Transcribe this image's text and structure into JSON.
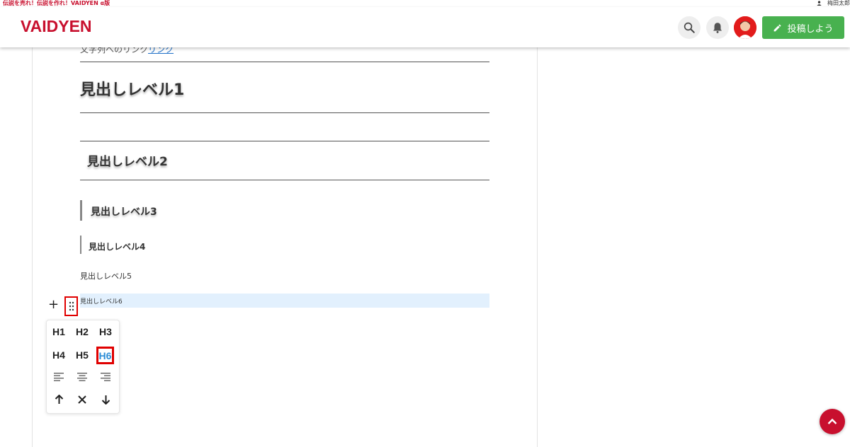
{
  "topbar": {
    "tagline": "伝説を売れ！伝説を作れ！VAIDYEN α版",
    "username": "梅田太郎"
  },
  "header": {
    "logo": "VAIDYEN",
    "post_button_label": "投稿しよう",
    "icons": [
      "search-icon",
      "bell-icon",
      "avatar",
      "pencil-icon"
    ]
  },
  "content": {
    "link_prefix": "文字列へのリンク",
    "link_text": "リンク",
    "heading1": "見出しレベル1",
    "heading2": "見出しレベル2",
    "heading3": "見出しレベル3",
    "heading4": "見出しレベル4",
    "heading5": "見出しレベル5",
    "heading6": "見出しレベル6"
  },
  "block_toolbar": {
    "headings": [
      "H1",
      "H2",
      "H3",
      "H4",
      "H5",
      "H6"
    ],
    "selected_heading": "H6",
    "align_icons": [
      "align-left-icon",
      "align-center-icon",
      "align-right-icon"
    ],
    "action_icons": [
      "arrow-up-icon",
      "close-icon",
      "arrow-down-icon"
    ]
  },
  "colors": {
    "brand": "#c8102e",
    "post_button": "#48b14f",
    "selected_block": "#e2f0fd",
    "highlight_box": "#e00000",
    "selected_heading": "#2c8dd6"
  }
}
